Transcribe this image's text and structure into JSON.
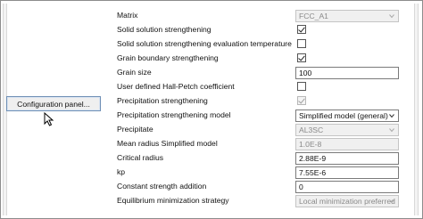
{
  "panel": {
    "config_button_label": "Configuration panel...",
    "rows": [
      {
        "label": "Matrix",
        "control": "select",
        "value": "FCC_A1",
        "disabled": true
      },
      {
        "label": "Solid solution strengthening",
        "control": "checkbox",
        "checked": true
      },
      {
        "label": "Solid solution strengthening evaluation temperature",
        "control": "checkbox",
        "checked": false
      },
      {
        "label": "Grain boundary strengthening",
        "control": "checkbox",
        "checked": true
      },
      {
        "label": "Grain size",
        "control": "text",
        "value": "100"
      },
      {
        "label": "User defined Hall-Petch coefficient",
        "control": "checkbox",
        "checked": false
      },
      {
        "label": "Precipitation strengthening",
        "control": "checkbox",
        "checked": true,
        "disabled": true
      },
      {
        "label": "Precipitation strengthening model",
        "control": "select",
        "value": "Simplified model (general)"
      },
      {
        "label": "Precipitate",
        "control": "select",
        "value": "AL3SC",
        "disabled": true
      },
      {
        "label": "Mean radius Simplified model",
        "control": "text",
        "value": "1.0E-8",
        "disabled": true
      },
      {
        "label": "Critical radius",
        "control": "text",
        "value": "2.88E-9"
      },
      {
        "label": "kp",
        "control": "text",
        "value": "7.55E-6"
      },
      {
        "label": "Constant strength addition",
        "control": "text",
        "value": "0"
      },
      {
        "label": "Equilibrium minimization strategy",
        "control": "select",
        "value": "Local minimization preferred",
        "disabled": true
      }
    ]
  },
  "icons": {
    "cursor": "mouse-pointer-icon",
    "dropdown": "chevron-down-icon",
    "check": "check-icon"
  }
}
